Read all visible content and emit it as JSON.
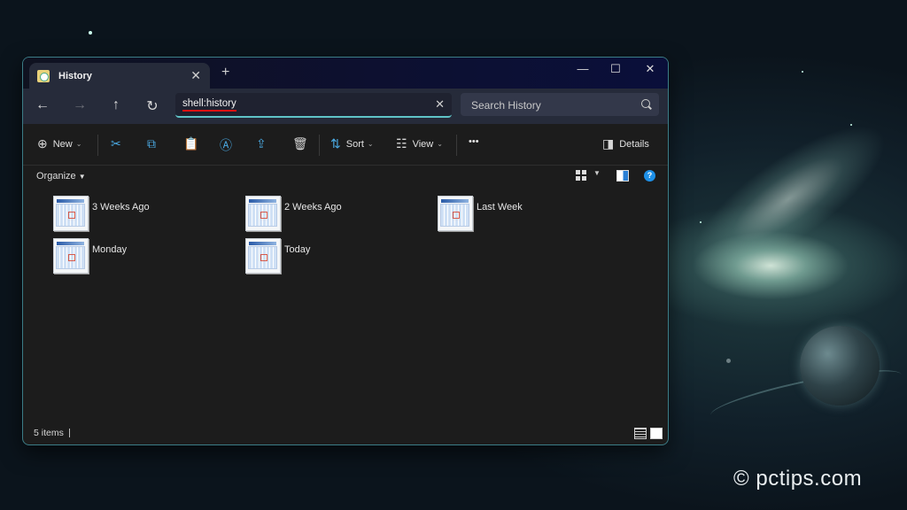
{
  "window": {
    "tab_title": "History",
    "tab_close_icon": "close-icon",
    "new_tab_symbol": "+",
    "controls": {
      "minimize": "—",
      "maximize": "☐",
      "close": "✕"
    }
  },
  "navigation": {
    "back": "←",
    "forward": "→",
    "up": "↑",
    "refresh": "↻",
    "address_value": "shell:history",
    "clear": "✕",
    "search_placeholder": "Search History"
  },
  "command_bar": {
    "new_label": "New",
    "sort_label": "Sort",
    "view_label": "View",
    "more_label": "•••",
    "details_label": "Details",
    "icons": {
      "new": "⊕",
      "cut": "✂",
      "copy": "⧉",
      "paste": "📋",
      "rename": "Ⓐ",
      "share": "⇪",
      "delete": "🗑",
      "sort": "⇅",
      "view": "☷",
      "details": "◨"
    }
  },
  "organize_bar": {
    "organize_label": "Organize",
    "help": "?"
  },
  "items": [
    {
      "label": "3 Weeks Ago"
    },
    {
      "label": "2 Weeks Ago"
    },
    {
      "label": "Last Week"
    },
    {
      "label": "Monday"
    },
    {
      "label": "Today"
    }
  ],
  "status": {
    "item_count": "5 items"
  },
  "watermark": "© pctips.com",
  "colors": {
    "accent": "#5fc4c7",
    "address_underline": "#dd1111",
    "help_blue": "#1e90e8"
  }
}
